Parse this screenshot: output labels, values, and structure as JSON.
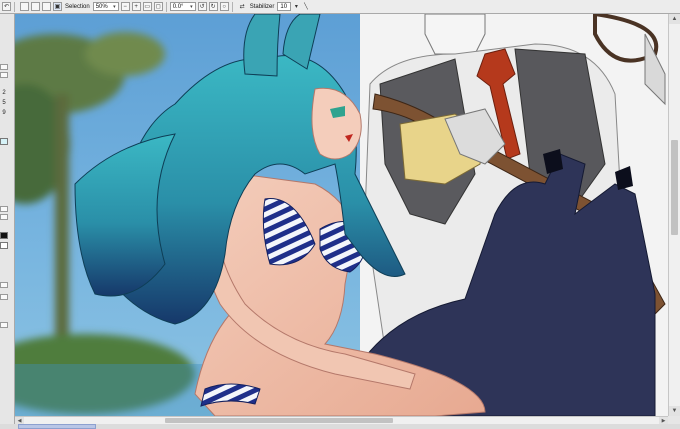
{
  "toolbar": {
    "selection_label": "Selection",
    "zoom_value": "50%",
    "rotation_value": "0.0°",
    "stabilizer_label": "Stabilizer",
    "stabilizer_value": "10",
    "icons": [
      "undo-icon",
      "redo-icon",
      "select-icon",
      "zoom-in-icon",
      "zoom-out-icon",
      "fit-icon",
      "rotate-left-icon",
      "rotate-right-icon",
      "reset-rotation-icon",
      "flip-icon",
      "pen-icon"
    ]
  },
  "left_panel": {
    "numbers": [
      "2",
      "5",
      "9"
    ]
  },
  "colors": {
    "sky": "#6aa6d6",
    "hair": "#2fa7b5",
    "bikini_stripe": "#1f2f8a",
    "suit_vest": "#55555a",
    "tie": "#b23a1e",
    "glove": "#e8d48a",
    "dark_figure": "#2e3458",
    "ui_toolbar": "#ececec"
  }
}
